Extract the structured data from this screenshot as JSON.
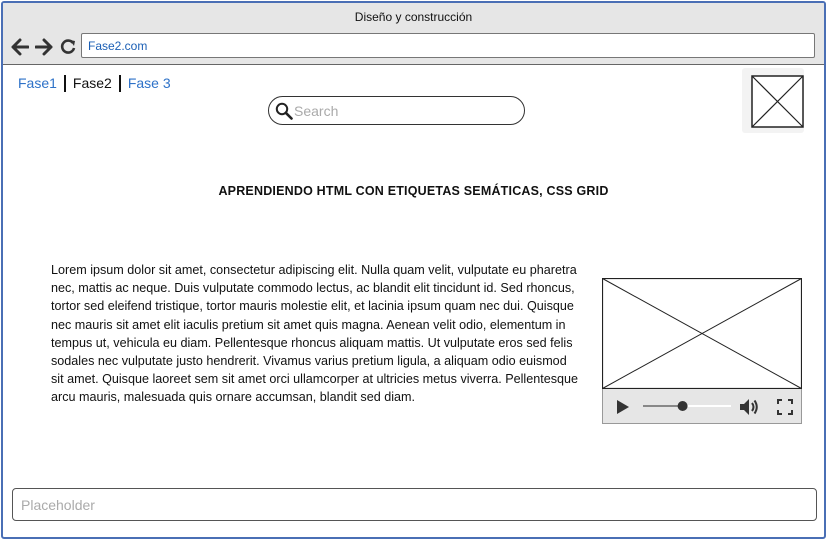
{
  "window": {
    "title": "Diseño y construcción"
  },
  "browser": {
    "url": "Fase2.com"
  },
  "breadcrumb": [
    {
      "label": "Fase1",
      "state": "link"
    },
    {
      "label": "Fase2",
      "state": "current"
    },
    {
      "label": "Fase 3",
      "state": "link"
    }
  ],
  "search": {
    "placeholder": "Search",
    "value": ""
  },
  "main": {
    "heading": "APRENDIENDO HTML CON ETIQUETAS SEMÁTICAS, CSS GRID",
    "paragraph": "Lorem ipsum dolor sit amet, consectetur adipiscing elit. Nulla quam velit, vulputate eu pharetra nec, mattis ac neque. Duis vulputate commodo lectus, ac blandit elit tincidunt id. Sed rhoncus, tortor sed eleifend tristique, tortor mauris molestie elit, et lacinia ipsum quam nec dui. Quisque nec mauris sit amet elit iaculis pretium sit amet quis magna. Aenean velit odio, elementum in tempus ut, vehicula eu diam. Pellentesque rhoncus aliquam mattis. Ut vulputate eros sed felis sodales nec vulputate justo hendrerit. Vivamus varius pretium ligula, a aliquam odio euismod sit amet. Quisque laoreet sem sit amet orci ullamcorper at ultricies metus viverra. Pellentesque arcu mauris, malesuada quis ornare accumsan, blandit sed diam."
  },
  "video": {
    "progress": 0.45
  },
  "footer_input": {
    "placeholder": "Placeholder",
    "value": ""
  },
  "colors": {
    "link": "#2e72c8",
    "frame_border": "#4a6fb5",
    "chrome": "#e6e6e6"
  },
  "icons": [
    "back-arrow-icon",
    "forward-arrow-icon",
    "reload-icon",
    "search-icon",
    "image-placeholder-icon",
    "play-icon",
    "volume-icon",
    "fullscreen-icon"
  ]
}
